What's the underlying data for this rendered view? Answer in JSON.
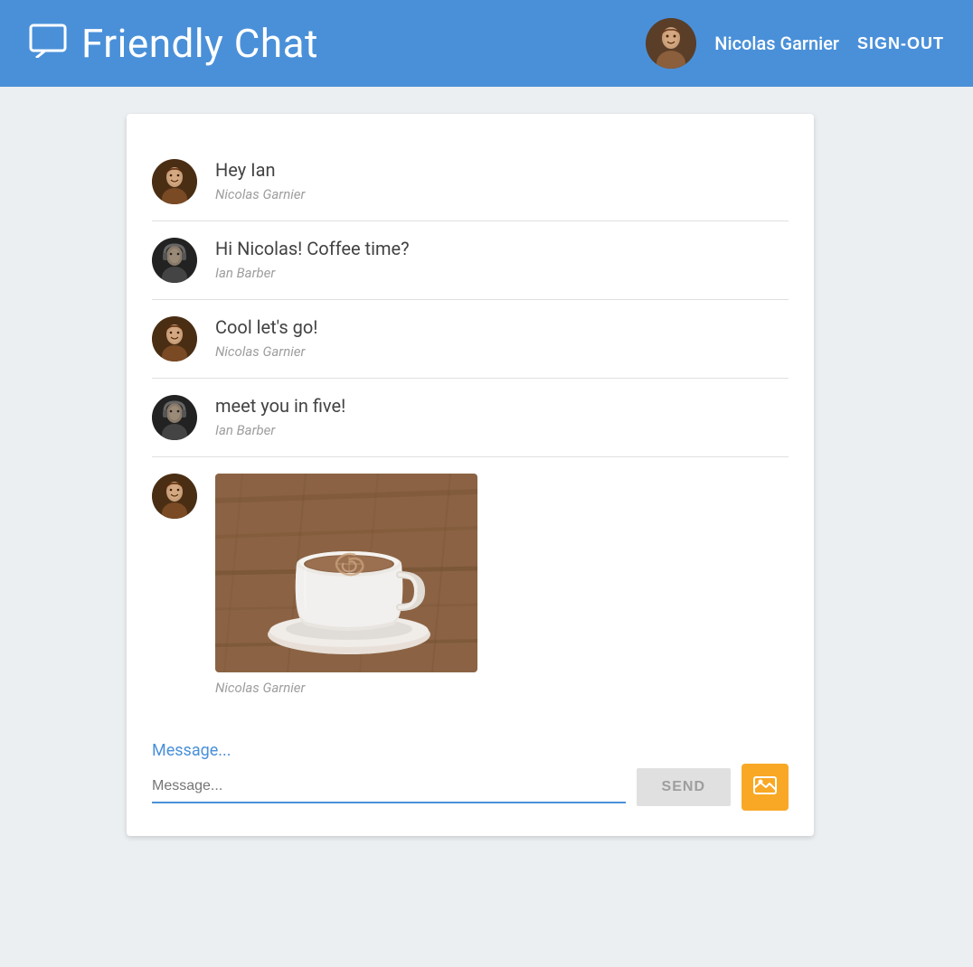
{
  "header": {
    "title": "Friendly Chat",
    "chat_icon": "💬",
    "user_name": "Nicolas Garnier",
    "sign_out_label": "SIGN-OUT"
  },
  "messages": [
    {
      "id": 1,
      "text": "Hey Ian",
      "sender": "Nicolas Garnier",
      "avatar_type": "nicolas",
      "has_image": false
    },
    {
      "id": 2,
      "text": "Hi Nicolas! Coffee time?",
      "sender": "Ian Barber",
      "avatar_type": "ian",
      "has_image": false
    },
    {
      "id": 3,
      "text": "Cool let's go!",
      "sender": "Nicolas Garnier",
      "avatar_type": "nicolas",
      "has_image": false
    },
    {
      "id": 4,
      "text": "meet you in five!",
      "sender": "Ian Barber",
      "avatar_type": "ian",
      "has_image": false
    },
    {
      "id": 5,
      "text": "",
      "sender": "Nicolas Garnier",
      "avatar_type": "nicolas",
      "has_image": true
    }
  ],
  "input": {
    "placeholder": "Message...",
    "send_label": "SEND",
    "image_upload_tooltip": "Upload image"
  }
}
